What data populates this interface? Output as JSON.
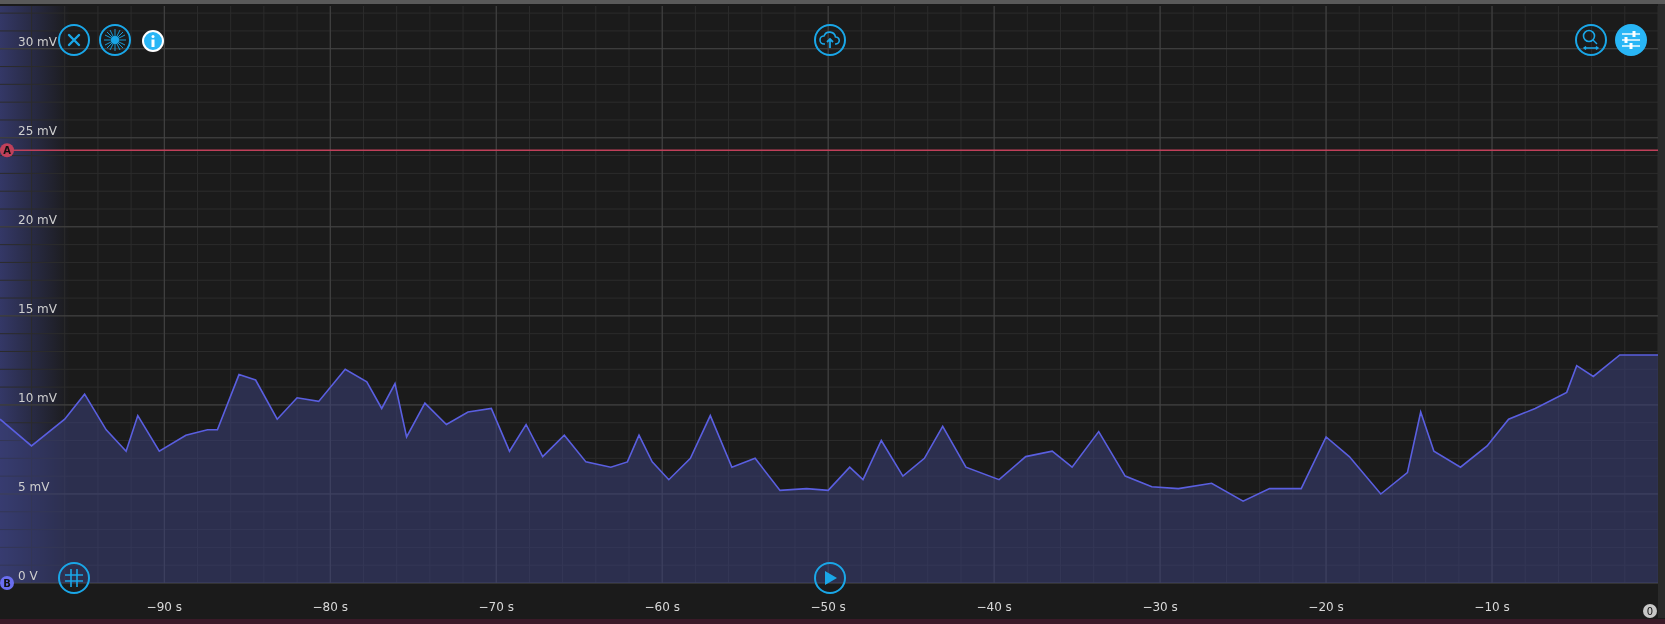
{
  "toolbar": {
    "settings_active": true
  },
  "time_marker": {
    "label": "0"
  },
  "chart_data": {
    "type": "line",
    "grid": true,
    "xlim": [
      -99.9,
      0
    ],
    "ylim": [
      0,
      32.4
    ],
    "xticks": [
      {
        "value": -90,
        "label": "−90 s"
      },
      {
        "value": -80,
        "label": "−80 s"
      },
      {
        "value": -70,
        "label": "−70 s"
      },
      {
        "value": -60,
        "label": "−60 s"
      },
      {
        "value": -50,
        "label": "−50 s"
      },
      {
        "value": -40,
        "label": "−40 s"
      },
      {
        "value": -30,
        "label": "−30 s"
      },
      {
        "value": -20,
        "label": "−20 s"
      },
      {
        "value": -10,
        "label": "−10 s"
      }
    ],
    "yticks": [
      {
        "value": 0,
        "label": "0 V"
      },
      {
        "value": 5,
        "label": "5 mV"
      },
      {
        "value": 10,
        "label": "10 mV"
      },
      {
        "value": 15,
        "label": "15 mV"
      },
      {
        "value": 20,
        "label": "20 mV"
      },
      {
        "value": 25,
        "label": "25 mV"
      },
      {
        "value": 30,
        "label": "30 mV"
      }
    ],
    "x": [
      -99.9,
      -98,
      -96,
      -94.8,
      -93.5,
      -92.3,
      -91.6,
      -90.3,
      -88.7,
      -87.4,
      -86.8,
      -85.5,
      -84.5,
      -83.2,
      -82,
      -80.7,
      -79.1,
      -77.8,
      -76.9,
      -76.1,
      -75.4,
      -74.3,
      -73,
      -71.7,
      -70.3,
      -69.2,
      -68.2,
      -67.2,
      -65.9,
      -64.6,
      -63.1,
      -62.1,
      -61.4,
      -60.6,
      -59.6,
      -58.3,
      -57.1,
      -55.8,
      -54.4,
      -52.9,
      -51.3,
      -50,
      -48.7,
      -47.9,
      -46.8,
      -45.5,
      -44.2,
      -43.1,
      -41.7,
      -39.7,
      -38.1,
      -36.5,
      -35.3,
      -33.7,
      -32.1,
      -30.5,
      -28.9,
      -26.9,
      -25,
      -23.4,
      -21.5,
      -20,
      -18.6,
      -16.7,
      -15.1,
      -14.3,
      -13.5,
      -11.9,
      -10.3,
      -9,
      -7.4,
      -5.5,
      -4.9,
      -3.9,
      -2.3,
      0
    ],
    "series": [
      {
        "name": "A",
        "color": "#c0405a",
        "values": [
          24.3,
          24.3,
          24.3,
          24.3,
          24.3,
          24.3,
          24.3,
          24.3,
          24.3,
          24.3,
          24.3,
          24.3,
          24.3,
          24.3,
          24.3,
          24.3,
          24.3,
          24.3,
          24.3,
          24.3,
          24.3,
          24.3,
          24.3,
          24.3,
          24.3,
          24.3,
          24.3,
          24.3,
          24.3,
          24.3,
          24.3,
          24.3,
          24.3,
          24.3,
          24.3,
          24.3,
          24.3,
          24.3,
          24.3,
          24.3,
          24.3,
          24.3,
          24.3,
          24.3,
          24.3,
          24.3,
          24.3,
          24.3,
          24.3,
          24.3,
          24.3,
          24.3,
          24.3,
          24.3,
          24.3,
          24.3,
          24.3,
          24.3,
          24.3,
          24.3,
          24.3,
          24.3,
          24.3,
          24.3,
          24.3,
          24.3,
          24.3,
          24.3,
          24.3,
          24.3,
          24.3,
          24.3,
          24.3,
          24.3,
          24.3,
          24.3
        ]
      },
      {
        "name": "B",
        "color": "#5a5fe0",
        "values": [
          9.2,
          7.7,
          9.2,
          10.6,
          8.6,
          7.4,
          9.4,
          7.4,
          8.3,
          8.6,
          8.6,
          11.7,
          11.4,
          9.2,
          10.4,
          10.2,
          12.0,
          11.3,
          9.8,
          11.2,
          8.2,
          10.1,
          8.9,
          9.6,
          9.8,
          7.4,
          8.9,
          7.1,
          8.3,
          6.8,
          6.5,
          6.8,
          8.3,
          6.8,
          5.8,
          7.0,
          9.4,
          6.5,
          7.0,
          5.2,
          5.3,
          5.2,
          6.5,
          5.8,
          8.0,
          6.0,
          7.0,
          8.8,
          6.5,
          5.8,
          7.1,
          7.4,
          6.5,
          8.5,
          6.0,
          5.4,
          5.3,
          5.6,
          4.6,
          5.3,
          5.3,
          8.2,
          7.1,
          5.0,
          6.2,
          9.6,
          7.4,
          6.5,
          7.7,
          9.2,
          9.8,
          10.7,
          12.2,
          11.6,
          12.8,
          12.8
        ]
      }
    ]
  }
}
